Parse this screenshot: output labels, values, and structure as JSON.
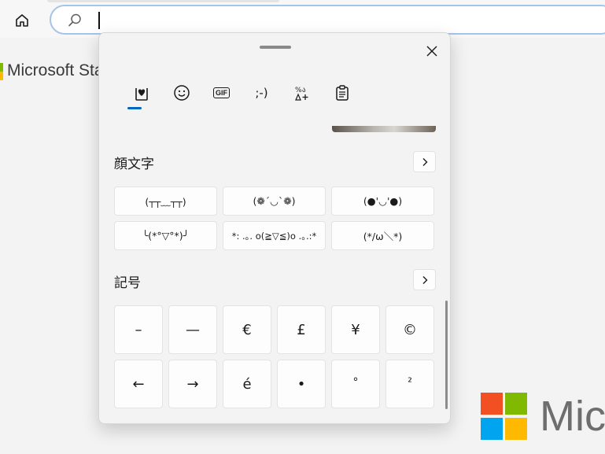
{
  "browser": {
    "address_value": "",
    "address_placeholder": ""
  },
  "page": {
    "store_title": "Microsoft Sta",
    "brand_word": "Micr",
    "brand_colors": [
      "#f25022",
      "#7fba00",
      "#00a4ef",
      "#ffb900"
    ]
  },
  "emoji_panel": {
    "close_label": "✕",
    "tabs": [
      {
        "name": "favorites",
        "icon": "heart-clipboard-icon",
        "active": true
      },
      {
        "name": "emoji",
        "icon": "smiley-icon",
        "glyph": "☺"
      },
      {
        "name": "gif",
        "icon": "gif-icon",
        "glyph": "GIF"
      },
      {
        "name": "kaomoji",
        "icon": "kaomoji-icon",
        "glyph": ";-)"
      },
      {
        "name": "symbols",
        "icon": "symbols-icon",
        "glyph": "%ᘓ\n∆+"
      },
      {
        "name": "clipboard",
        "icon": "clipboard-icon"
      }
    ],
    "accent_color": "#0067c0",
    "kaomoji_section": {
      "title": "顔文字",
      "more_label": "›",
      "items": [
        "(┬┬﹏┬┬)",
        "(❁´◡`❁)",
        "(●'◡'●)",
        "╰(*°▽°*)╯",
        "*: .｡. o(≧▽≦)o .｡.:*",
        "(*/ω＼*)"
      ]
    },
    "symbols_section": {
      "title": "記号",
      "more_label": "›",
      "items": [
        "–",
        "—",
        "€",
        "£",
        "¥",
        "©",
        "←",
        "→",
        "é",
        "•",
        "°",
        "²"
      ]
    }
  }
}
